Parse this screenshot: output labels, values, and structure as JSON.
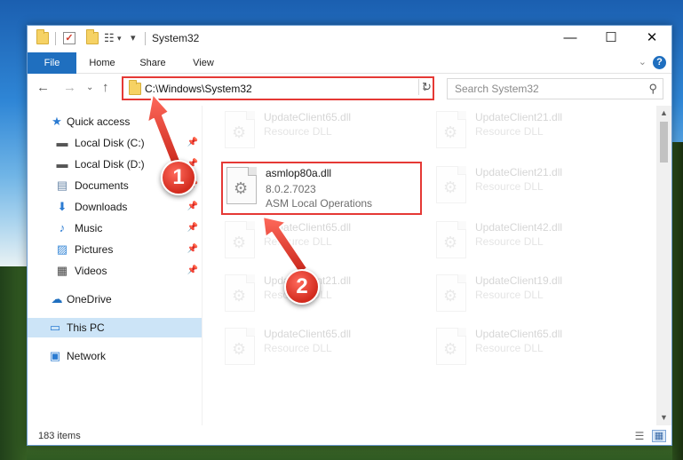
{
  "window": {
    "title": "System32"
  },
  "ribbon": {
    "tabs": [
      "File",
      "Home",
      "Share",
      "View"
    ]
  },
  "nav": {
    "address": "C:\\Windows\\System32",
    "search_placeholder": "Search System32"
  },
  "sidebar": {
    "items": [
      {
        "label": "Quick access",
        "icon": "star-icon"
      },
      {
        "label": "Local Disk (C:)",
        "icon": "drive-icon",
        "pinned": true
      },
      {
        "label": "Local Disk (D:)",
        "icon": "drive-icon",
        "pinned": true
      },
      {
        "label": "Documents",
        "icon": "documents-icon",
        "pinned": true
      },
      {
        "label": "Downloads",
        "icon": "download-icon",
        "pinned": true
      },
      {
        "label": "Music",
        "icon": "music-icon",
        "pinned": true
      },
      {
        "label": "Pictures",
        "icon": "pictures-icon",
        "pinned": true
      },
      {
        "label": "Videos",
        "icon": "videos-icon",
        "pinned": true
      },
      {
        "label": "OneDrive",
        "icon": "cloud-icon"
      },
      {
        "label": "This PC",
        "icon": "computer-icon",
        "selected": true
      },
      {
        "label": "Network",
        "icon": "network-icon"
      }
    ]
  },
  "files": {
    "left": [
      {
        "name": "UpdateClient65.dll",
        "type": "Resource DLL"
      },
      {
        "name": "asmlop80a.dll",
        "version": "8.0.2.7023",
        "description": "ASM Local Operations",
        "selected": true
      },
      {
        "name": "UpdateClient65.dll",
        "type": "Resource DLL"
      },
      {
        "name": "UpdateClient21.dll",
        "type": "Resource DLL"
      },
      {
        "name": "UpdateClient65.dll",
        "type": "Resource DLL"
      }
    ],
    "right": [
      {
        "name": "UpdateClient21.dll",
        "type": "Resource DLL"
      },
      {
        "name": "UpdateClient21.dll",
        "type": "Resource DLL"
      },
      {
        "name": "UpdateClient42.dll",
        "type": "Resource DLL"
      },
      {
        "name": "UpdateClient19.dll",
        "type": "Resource DLL"
      },
      {
        "name": "UpdateClient65.dll",
        "type": "Resource DLL"
      }
    ]
  },
  "status": {
    "item_count": "183 items"
  },
  "annotations": {
    "step1": "1",
    "step2": "2",
    "color": "#e53935"
  }
}
